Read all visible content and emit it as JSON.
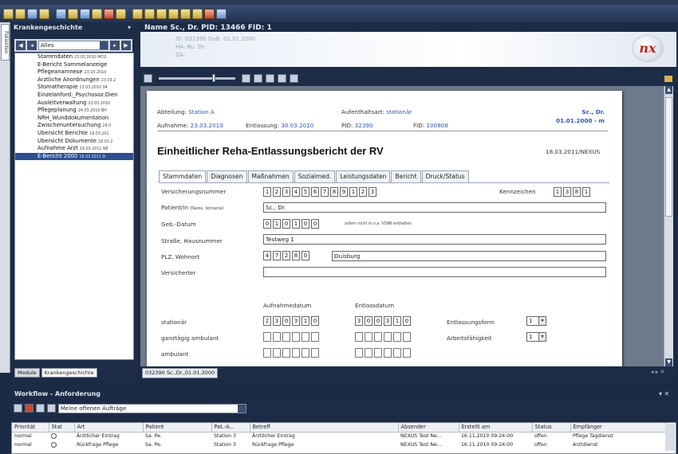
{
  "header": {
    "title": "Name Sc., Dr. PID: 13466 FID: 1",
    "info_line1": "ID: 032390 DoB: 01.01.2000",
    "info_line2": "HA: Ru. Dr.",
    "info_line3": "ZA:",
    "logo_text": "nx"
  },
  "left_panel": {
    "vertical_tab": "Patienten",
    "title": "Krankengeschichte",
    "filter_value": "Alles",
    "items": [
      {
        "label": "Stammdaten",
        "date": "23.03.2010 MCO"
      },
      {
        "label": "E-Bericht Sammelanzeige",
        "date": ""
      },
      {
        "label": "Pflegeanamnese",
        "date": "23.03.2010"
      },
      {
        "label": "Ärztliche Anordnungen",
        "date": "23.03.2"
      },
      {
        "label": "Stomatherapie",
        "date": "23.03.2010 04"
      },
      {
        "label": "Einzelanford._Psychosoz.Dien",
        "date": ""
      },
      {
        "label": "Ausleitverwaltung",
        "date": "23.03.2010"
      },
      {
        "label": "Pflegeplanung",
        "date": "24.03.2010 BH"
      },
      {
        "label": "NRH_Wunddokumentation",
        "date": ""
      },
      {
        "label": "Zwischenuntersuchung",
        "date": "29.0"
      },
      {
        "label": "Übersicht Berichte",
        "date": "18.03.201"
      },
      {
        "label": "Übersicht Dokumente",
        "date": "18.03.2"
      },
      {
        "label": "Aufnahme Arzt",
        "date": "18.03.2011 NE"
      },
      {
        "label": "E-Bericht 2000",
        "date": "18.03.2011 N"
      }
    ],
    "tabs": [
      "Module",
      "Krankengeschichte"
    ]
  },
  "document": {
    "abteilung_label": "Abteilung:",
    "abteilung_value": "Station A",
    "aufenthalt_label": "Aufenthaltsart:",
    "aufenthalt_value": "stationär",
    "patient_name": "Sc., Dr.",
    "patient_dob": "01.01.2000 - m",
    "aufnahme_label": "Aufnahme:",
    "aufnahme_value": "23.03.2010",
    "entlassung_label": "Entlassung:",
    "entlassung_value": "30.03.2010",
    "pid_label": "PID:",
    "pid_value": "32390",
    "fid_label": "FID:",
    "fid_value": "100808",
    "title": "Einheitlicher Reha-Entlassungsbericht der RV",
    "date_right": "18.03.2011/NEXUS",
    "tabs": [
      "Stammdaten",
      "Diagnosen",
      "Maßnahmen",
      "Sozialmed.",
      "Leistungsdaten",
      "Bericht",
      "Druck/Status"
    ],
    "versicherungsnummer_label": "Versicherungsnummer",
    "versicherungsnummer": [
      "1",
      "2",
      "3",
      "4",
      "5",
      "6",
      "7",
      "8",
      "9",
      "1",
      "2",
      "3"
    ],
    "kennzeichen_label": "Kennzeichen",
    "kennzeichen": [
      "1",
      "3",
      "8",
      "1"
    ],
    "patientin_label": "Patient/in",
    "patientin_hint": "(Name, Vorname)",
    "patientin_value": "Sc., Dr.",
    "geb_label": "Geb.-Datum",
    "geb": [
      "0",
      "1",
      "0",
      "1",
      "0",
      "0"
    ],
    "geb_hint": "sofern nicht in o.a. VSNR enthalten",
    "strasse_label": "Straße, Hausnummer",
    "strasse_value": "Testweg 1",
    "plz_label": "PLZ, Wohnort",
    "plz": [
      "4",
      "7",
      "2",
      "8",
      "0"
    ],
    "wohnort_value": "Duisburg",
    "versicherter_label": "Versicherter",
    "versicherter_value": "",
    "aufnahmedatum_label": "Aufnahmedatum",
    "entlassdatum_label": "Entlassdatum",
    "stationaer_label": "stationär",
    "aufnahme_boxes": [
      "2",
      "3",
      "0",
      "3",
      "1",
      "0"
    ],
    "entlass_boxes": [
      "3",
      "0",
      "0",
      "3",
      "1",
      "0"
    ],
    "ganztaegig_label": "ganztägig ambulant",
    "ambulant_label": "ambulant",
    "entlassungsform_label": "Entlassungsform",
    "entlassungsform_value": "1",
    "arbeitsfaehigkeit_label": "Arbeitsfähigkeit",
    "arbeitsfaehigkeit_value": "1"
  },
  "doc_tab": "032390 Sc.,Dr.,01.01.2000",
  "workflow": {
    "title": "Workflow - Anforderung",
    "filter_value": "Meine offenen Aufträge",
    "columns": [
      "Priorität",
      "Stat",
      "Art",
      "Patient",
      "Pat.-A...",
      "Betreff",
      "Absender",
      "Erstellt am",
      "Status",
      "Empfänger"
    ],
    "rows": [
      [
        "normal",
        "",
        "Ärztlicher Eintrag",
        "Sa. Pe.",
        "Station 3",
        "Ärztlicher Eintrag",
        "NEXUS Test Ne...",
        "16.11.2010 09:24:00",
        "offen",
        "Pflege Tagdienst"
      ],
      [
        "normal",
        "",
        "Rückfrage Pflege",
        "Sa. Pe.",
        "Station 3",
        "Rückfrage Pflege",
        "NEXUS Test Ne...",
        "16.11.2010 09:24:00",
        "offen",
        "Arztdienst"
      ]
    ]
  }
}
